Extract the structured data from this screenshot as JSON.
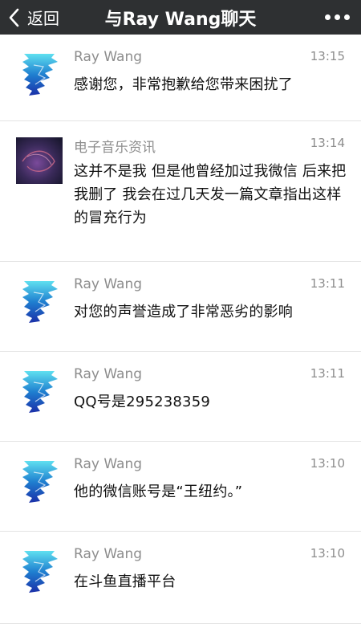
{
  "nav": {
    "back_label": "返回",
    "title": "与Ray Wang聊天",
    "back_icon": "chevron-left-icon",
    "more_icon": "more-dots-icon"
  },
  "messages": [
    {
      "sender": "Ray Wang",
      "time": "13:15",
      "text": "感谢您，非常抱歉给您带来困扰了",
      "avatar": "ray"
    },
    {
      "sender": "电子音乐资讯",
      "time": "13:14",
      "text": "这并不是我 但是他曾经加过我微信 后来把我删了 我会在过几天发一篇文章指出这样的冒充行为",
      "avatar": "music"
    },
    {
      "sender": "Ray Wang",
      "time": "13:11",
      "text": "对您的声誉造成了非常恶劣的影响",
      "avatar": "ray"
    },
    {
      "sender": "Ray Wang",
      "time": "13:11",
      "text": "QQ号是295238359",
      "avatar": "ray"
    },
    {
      "sender": "Ray Wang",
      "time": "13:10",
      "text": "他的微信账号是“王纽约。”",
      "avatar": "ray"
    },
    {
      "sender": "Ray Wang",
      "time": "13:10",
      "text": "在斗鱼直播平台",
      "avatar": "ray"
    }
  ]
}
